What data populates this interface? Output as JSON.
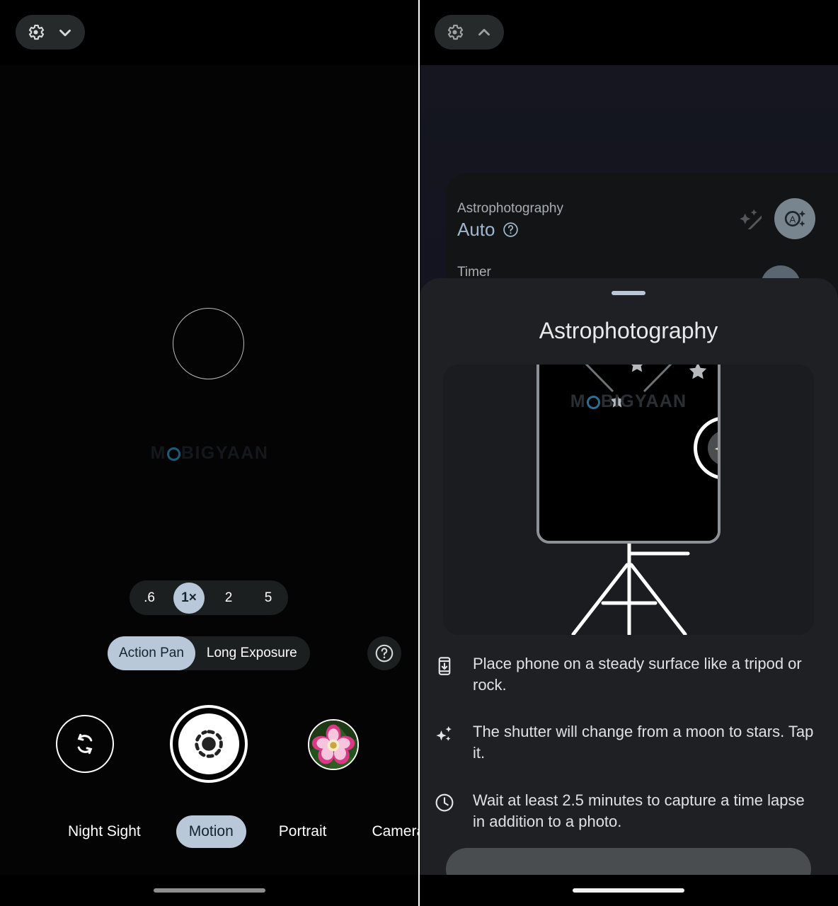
{
  "left_panel": {
    "settings_pill": {
      "gear": "gear-icon",
      "chevron": "chevron-down-icon"
    },
    "zoom": {
      "options": [
        ".6",
        "1×",
        "2",
        "5"
      ],
      "selected": "1×"
    },
    "motion_submodes": {
      "options": [
        "Action Pan",
        "Long Exposure"
      ],
      "selected": "Action Pan"
    },
    "help_icon": "help-circle-icon",
    "controls": {
      "flip_camera": "flip-camera-icon",
      "shutter": "motion-shutter-icon",
      "gallery_thumbnail": "flower-thumbnail"
    },
    "modes": {
      "items": [
        "Night Sight",
        "Motion",
        "Portrait",
        "Camera"
      ],
      "selected": "Motion"
    },
    "watermark": "MOBIGYAAN"
  },
  "right_panel": {
    "settings_pill": {
      "gear": "gear-icon",
      "chevron": "chevron-up-icon"
    },
    "quick_settings": [
      {
        "label": "Astrophotography",
        "value": "Auto",
        "help": "?",
        "icons": [
          "astro-off-icon",
          "astro-auto-icon"
        ],
        "selected_icon": "astro-auto-icon"
      },
      {
        "label": "Timer",
        "value": ""
      }
    ],
    "sheet": {
      "title": "Astrophotography",
      "illustration": {
        "watermark": "MOBIGYAAN",
        "alt": "phone-on-tripod-night-sky-illustration"
      },
      "tips": [
        {
          "icon": "phone-steady-icon",
          "text": "Place phone on a steady surface like a tripod or rock."
        },
        {
          "icon": "sparkles-icon",
          "text": "The shutter will change from a moon to stars. Tap it."
        },
        {
          "icon": "clock-icon",
          "text": "Wait at least 2.5 minutes to capture a time lapse in addition to a photo."
        }
      ]
    }
  },
  "colors": {
    "accent_blue": "#b8c8d8",
    "sheet_bg": "#1e2023",
    "pill_bg": "#1c1f20",
    "value_blue": "#9fb6cc"
  }
}
